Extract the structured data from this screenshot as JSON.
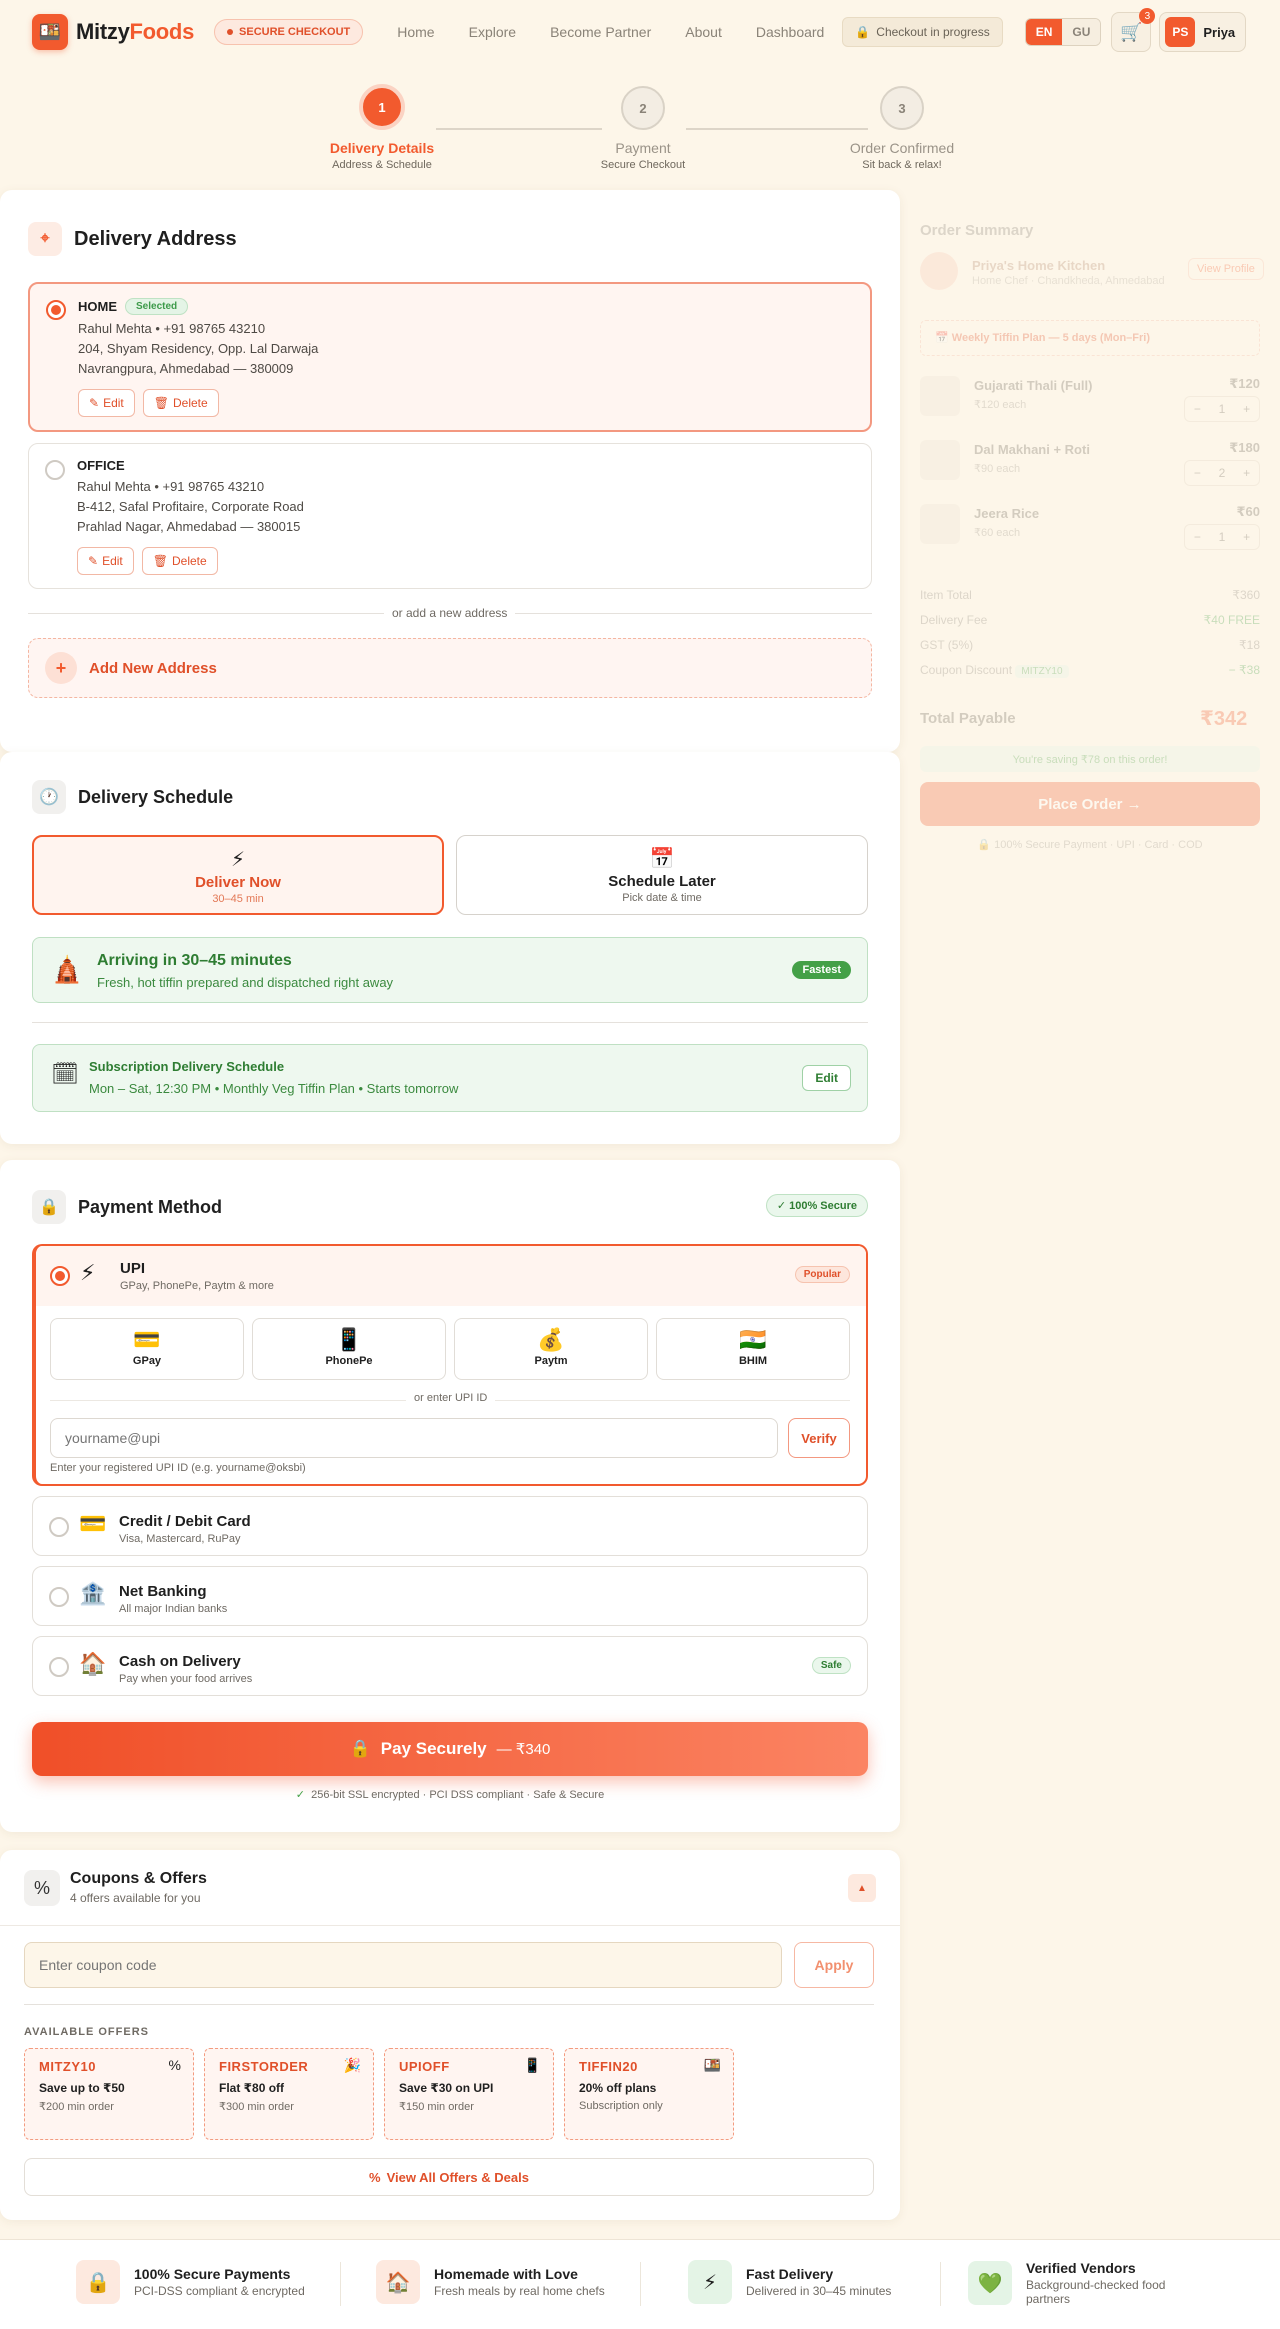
{
  "header": {
    "brand_main": "Mitzy",
    "brand_accent": "Foods",
    "secure_badge": "SECURE CHECKOUT",
    "nav": [
      "Home",
      "Explore",
      "Become Partner",
      "About",
      "Dashboard"
    ],
    "checkout_status": "Checkout in progress",
    "lang_en": "EN",
    "lang_gu": "GU",
    "cart_count": "3",
    "user_initials": "PS",
    "user_name": "Priya"
  },
  "stepper": [
    {
      "num": "1",
      "title": "Delivery Details",
      "sub": "Address & Schedule"
    },
    {
      "num": "2",
      "title": "Payment",
      "sub": "Secure Checkout"
    },
    {
      "num": "3",
      "title": "Order Confirmed",
      "sub": "Sit back & relax!"
    }
  ],
  "address": {
    "title": "Delivery Address",
    "selected_label": "Selected",
    "edit": "Edit",
    "delete": "Delete",
    "or_text": "or add a new address",
    "add_new": "Add New Address",
    "items": [
      {
        "type": "HOME",
        "contact": "Rahul Mehta • +91 98765 43210",
        "line1": "204, Shyam Residency, Opp. Lal Darwaja",
        "line2": "Navrangpura, Ahmedabad — 380009"
      },
      {
        "type": "OFFICE",
        "contact": "Rahul Mehta • +91 98765 43210",
        "line1": "B-412, Safal Profitaire, Corporate Road",
        "line2": "Prahlad Nagar, Ahmedabad — 380015"
      }
    ]
  },
  "schedule": {
    "title": "Delivery Schedule",
    "now_title": "Deliver Now",
    "now_sub": "30–45 min",
    "later_title": "Schedule Later",
    "later_sub": "Pick date & time",
    "arriving_title": "Arriving in 30–45 minutes",
    "arriving_sub": "Fresh, hot tiffin prepared and dispatched right away",
    "fastest": "Fastest",
    "sub_title": "Subscription Delivery Schedule",
    "sub_detail": "Mon – Sat, 12:30 PM • Monthly Veg Tiffin Plan • Starts tomorrow",
    "sub_edit": "Edit"
  },
  "payment": {
    "title": "Payment Method",
    "secure_badge": "100% Secure",
    "upi_title": "UPI",
    "upi_sub": "GPay, PhonePe, Paytm & more",
    "popular": "Popular",
    "apps": [
      "GPay",
      "PhonePe",
      "Paytm",
      "BHIM"
    ],
    "or_upi": "or enter UPI ID",
    "upi_placeholder": "yourname@upi",
    "verify": "Verify",
    "upi_hint": "Enter your registered UPI ID (e.g. yourname@oksbi)",
    "card_title": "Credit / Debit Card",
    "card_sub": "Visa, Mastercard, RuPay",
    "nb_title": "Net Banking",
    "nb_sub": "All major Indian banks",
    "cod_title": "Cash on Delivery",
    "cod_sub": "Pay when your food arrives",
    "cod_badge": "Safe",
    "pay_label": "Pay Securely",
    "pay_amount": "— ₹340",
    "ssl_note": "256-bit SSL encrypted · PCI DSS compliant · Safe & Secure"
  },
  "coupons": {
    "title": "Coupons & Offers",
    "sub": "4 offers available for you",
    "placeholder": "Enter coupon code",
    "apply": "Apply",
    "available_label": "AVAILABLE OFFERS",
    "offers": [
      {
        "code": "MITZY10",
        "title": "Save up to ₹50",
        "min": "₹200 min order",
        "icon": "%"
      },
      {
        "code": "FIRSTORDER",
        "title": "Flat ₹80 off",
        "min": "₹300 min order",
        "icon": "🎉"
      },
      {
        "code": "UPIOFF",
        "title": "Save ₹30 on UPI",
        "min": "₹150 min order",
        "icon": "📱"
      },
      {
        "code": "TIFFIN20",
        "title": "20% off plans",
        "min": "Subscription only",
        "icon": "🍱"
      }
    ],
    "view_all": "View All Offers & Deals"
  },
  "summary": {
    "title": "Order Summary",
    "kitchen": "Priya's Home Kitchen",
    "kitchen_sub": "Home Chef · Chandkheda, Ahmedabad",
    "view_profile": "View Profile",
    "plan": "Weekly Tiffin Plan — 5 days (Mon–Fri)",
    "items": [
      {
        "name": "Gujarati Thali (Full)",
        "each": "₹120 each",
        "price": "₹120",
        "qty": "1"
      },
      {
        "name": "Dal Makhani + Roti",
        "each": "₹90 each",
        "price": "₹180",
        "qty": "2"
      },
      {
        "name": "Jeera Rice",
        "each": "₹60 each",
        "price": "₹60",
        "qty": "1"
      }
    ],
    "rows": [
      {
        "label": "Item Total",
        "value": "₹360"
      },
      {
        "label": "Delivery Fee",
        "value": "₹40 FREE"
      },
      {
        "label": "GST (5%)",
        "value": "₹18"
      },
      {
        "label": "Coupon Discount",
        "value": "− ₹38",
        "code": "MITZY10"
      }
    ],
    "total_label": "Total Payable",
    "total_value": "₹342",
    "saving": "You're saving ₹78 on this order!",
    "place_order": "Place Order →",
    "secure_note": "100% Secure Payment · UPI · Card · COD"
  },
  "footer": [
    {
      "title": "100% Secure Payments",
      "sub": "PCI-DSS compliant & encrypted",
      "icon": "🔒"
    },
    {
      "title": "Homemade with Love",
      "sub": "Fresh meals by real home chefs",
      "icon": "🏠"
    },
    {
      "title": "Fast Delivery",
      "sub": "Delivered in 30–45 minutes",
      "icon": "⚡"
    },
    {
      "title": "Verified Vendors",
      "sub": "Background-checked food partners",
      "icon": "💚"
    }
  ]
}
